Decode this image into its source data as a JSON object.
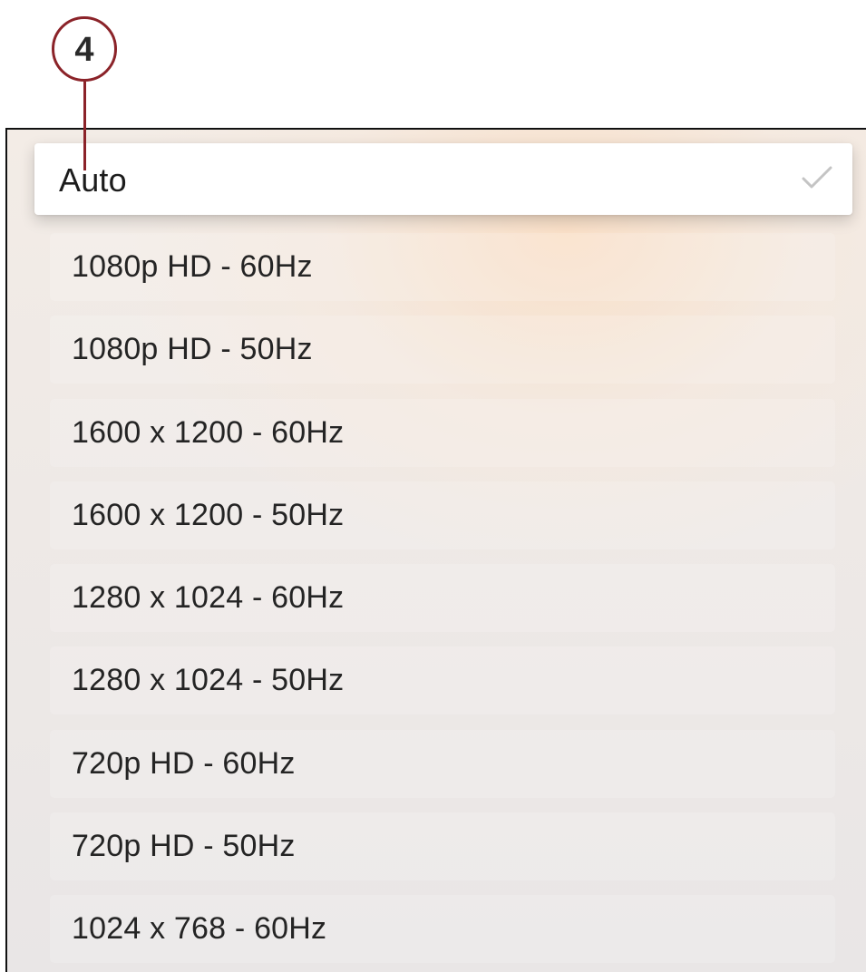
{
  "callout": {
    "number": "4",
    "color": "#8b2329"
  },
  "resolution_menu": {
    "selected_index": 0,
    "selected_icon": "checkmark-icon",
    "items": [
      {
        "label": "Auto"
      },
      {
        "label": "1080p HD - 60Hz"
      },
      {
        "label": "1080p HD - 50Hz"
      },
      {
        "label": "1600 x 1200 - 60Hz"
      },
      {
        "label": "1600 x 1200 - 50Hz"
      },
      {
        "label": "1280 x 1024 - 60Hz"
      },
      {
        "label": "1280 x 1024 - 50Hz"
      },
      {
        "label": "720p HD - 60Hz"
      },
      {
        "label": "720p HD - 50Hz"
      },
      {
        "label": "1024 x 768 - 60Hz"
      }
    ]
  }
}
